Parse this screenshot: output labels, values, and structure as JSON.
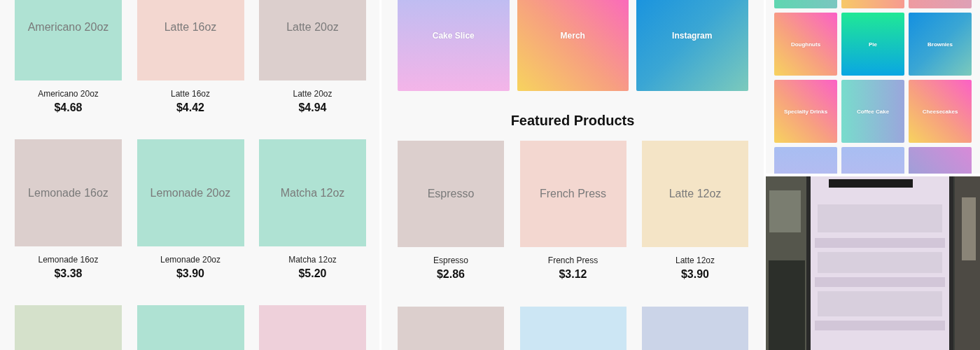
{
  "left_panel": {
    "products": [
      {
        "kind": "product",
        "tile_label": "Americano 20oz",
        "name": "Americano 20oz",
        "price": "$4.68",
        "color": "#afe2d3"
      },
      {
        "kind": "product",
        "tile_label": "Latte 16oz",
        "name": "Latte 16oz",
        "price": "$4.42",
        "color": "#f3d7d0"
      },
      {
        "kind": "product",
        "tile_label": "Latte 20oz",
        "name": "Latte 20oz",
        "price": "$4.94",
        "color": "#dccfcd"
      },
      {
        "kind": "product",
        "tile_label": "Lemonade 16oz",
        "name": "Lemonade 16oz",
        "price": "$3.38",
        "color": "#dccfcd"
      },
      {
        "kind": "product",
        "tile_label": "Lemonade 20oz",
        "name": "Lemonade 20oz",
        "price": "$3.90",
        "color": "#afe2d3"
      },
      {
        "kind": "product",
        "tile_label": "Matcha 12oz",
        "name": "Matcha 12oz",
        "price": "$5.20",
        "color": "#afe2d3"
      },
      {
        "kind": "blank",
        "color": "#d5e1cb"
      },
      {
        "kind": "blank",
        "color": "#afe2d3"
      },
      {
        "kind": "blank",
        "color": "#eed0da"
      }
    ]
  },
  "middle_panel": {
    "categories": [
      {
        "label": "Cake Slice",
        "kind": "lavender"
      },
      {
        "label": "Merch",
        "kind": "sunset"
      },
      {
        "label": "Instagram",
        "kind": "ocean"
      }
    ],
    "heading": "Featured Products",
    "products": [
      {
        "kind": "product",
        "tile_label": "Espresso",
        "name": "Espresso",
        "price": "$2.86",
        "color": "#dccfcd"
      },
      {
        "kind": "product",
        "tile_label": "French Press",
        "name": "French Press",
        "price": "$3.12",
        "color": "#f3d7d0"
      },
      {
        "kind": "product",
        "tile_label": "Latte 12oz",
        "name": "Latte 12oz",
        "price": "$3.90",
        "color": "#f4e4c6"
      },
      {
        "kind": "blank",
        "color": "#dccfcd"
      },
      {
        "kind": "blank",
        "color": "#cce6f4"
      },
      {
        "kind": "blank",
        "color": "#cbd4e8"
      }
    ]
  },
  "right_panel": {
    "categories": [
      {
        "kind": "mint"
      },
      {
        "kind": "peach"
      },
      {
        "kind": "rose"
      },
      {
        "label": "Doughnuts",
        "kind": "sunset"
      },
      {
        "label": "Pie",
        "kind": "emerald"
      },
      {
        "label": "Brownies",
        "kind": "ocean"
      },
      {
        "label": "Specialty Drinks",
        "kind": "sunset"
      },
      {
        "label": "Coffee Cake",
        "kind": "aqua"
      },
      {
        "label": "Cheesecakes",
        "kind": "sunset"
      },
      {
        "kind": "periwinkle"
      },
      {
        "kind": "periwinkle"
      },
      {
        "kind": "plum"
      }
    ]
  }
}
